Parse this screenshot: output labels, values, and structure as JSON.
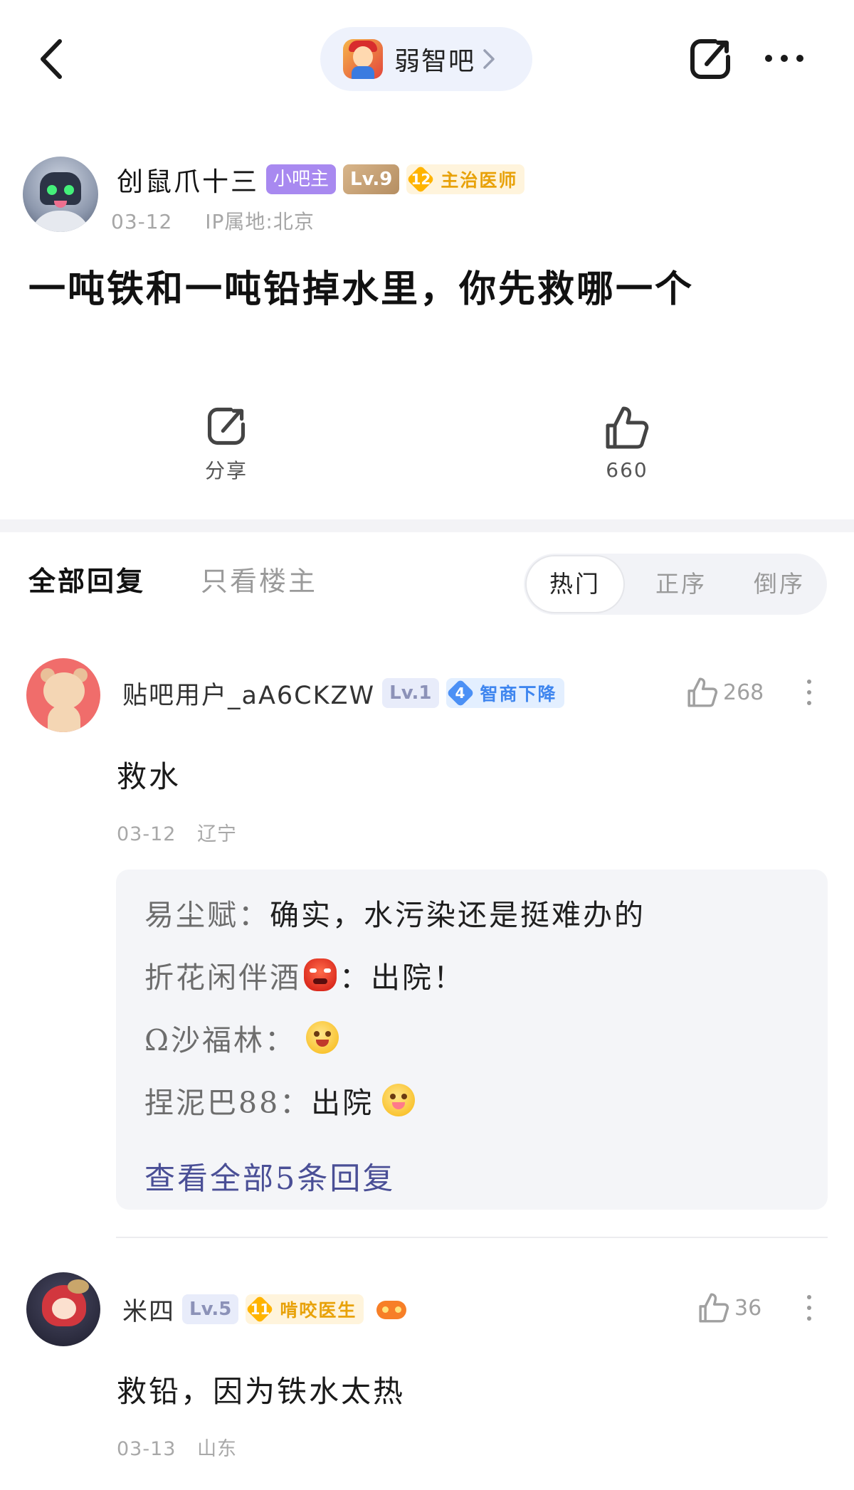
{
  "nav": {
    "forum_name": "弱智吧",
    "back_icon": "chevron-left-icon",
    "share_icon": "share-icon",
    "more_icon": "more-horizontal-icon"
  },
  "op": {
    "username": "创鼠爪十三",
    "mod_badge": "小吧主",
    "level_badge": "Lv.9",
    "title_badge": {
      "level": "12",
      "label": "主治医师"
    },
    "date": "03-12",
    "ip_location": "IP属地:北京",
    "post_title": "一吨铁和一吨铅掉水里，你先救哪一个"
  },
  "actions": {
    "share_label": "分享",
    "like_count": "660"
  },
  "replies_header": {
    "tab_all": "全部回复",
    "tab_op_only": "只看楼主",
    "sort_hot": "热门",
    "sort_asc": "正序",
    "sort_desc": "倒序"
  },
  "comments": [
    {
      "username": "贴吧用户_aA6CKZW",
      "level_badge": "Lv.1",
      "title_badge": {
        "level": "4",
        "label": "智商下降"
      },
      "like_count": "268",
      "text": "救水",
      "date": "03-12",
      "location": "辽宁",
      "sub_replies": [
        {
          "author": "易尘赋：",
          "text": "确实，水污染还是挺难办的"
        },
        {
          "author": "折花闲伴酒",
          "text": "：出院！"
        },
        {
          "author": "Ω沙福林：",
          "text": ""
        },
        {
          "author": "捏泥巴88：",
          "text": "出院"
        }
      ],
      "view_all": "查看全部5条回复"
    },
    {
      "username": "米四",
      "level_badge": "Lv.5",
      "title_badge": {
        "level": "11",
        "label": "啃咬医生"
      },
      "like_count": "36",
      "text": "救铅，因为铁水太热",
      "date": "03-13",
      "location": "山东"
    }
  ],
  "colors": {
    "accent_link": "#4a4f96",
    "mod_badge": "#a889f0",
    "title_badge_orange": "#ffb400",
    "title_badge_blue": "#4b90f5"
  }
}
